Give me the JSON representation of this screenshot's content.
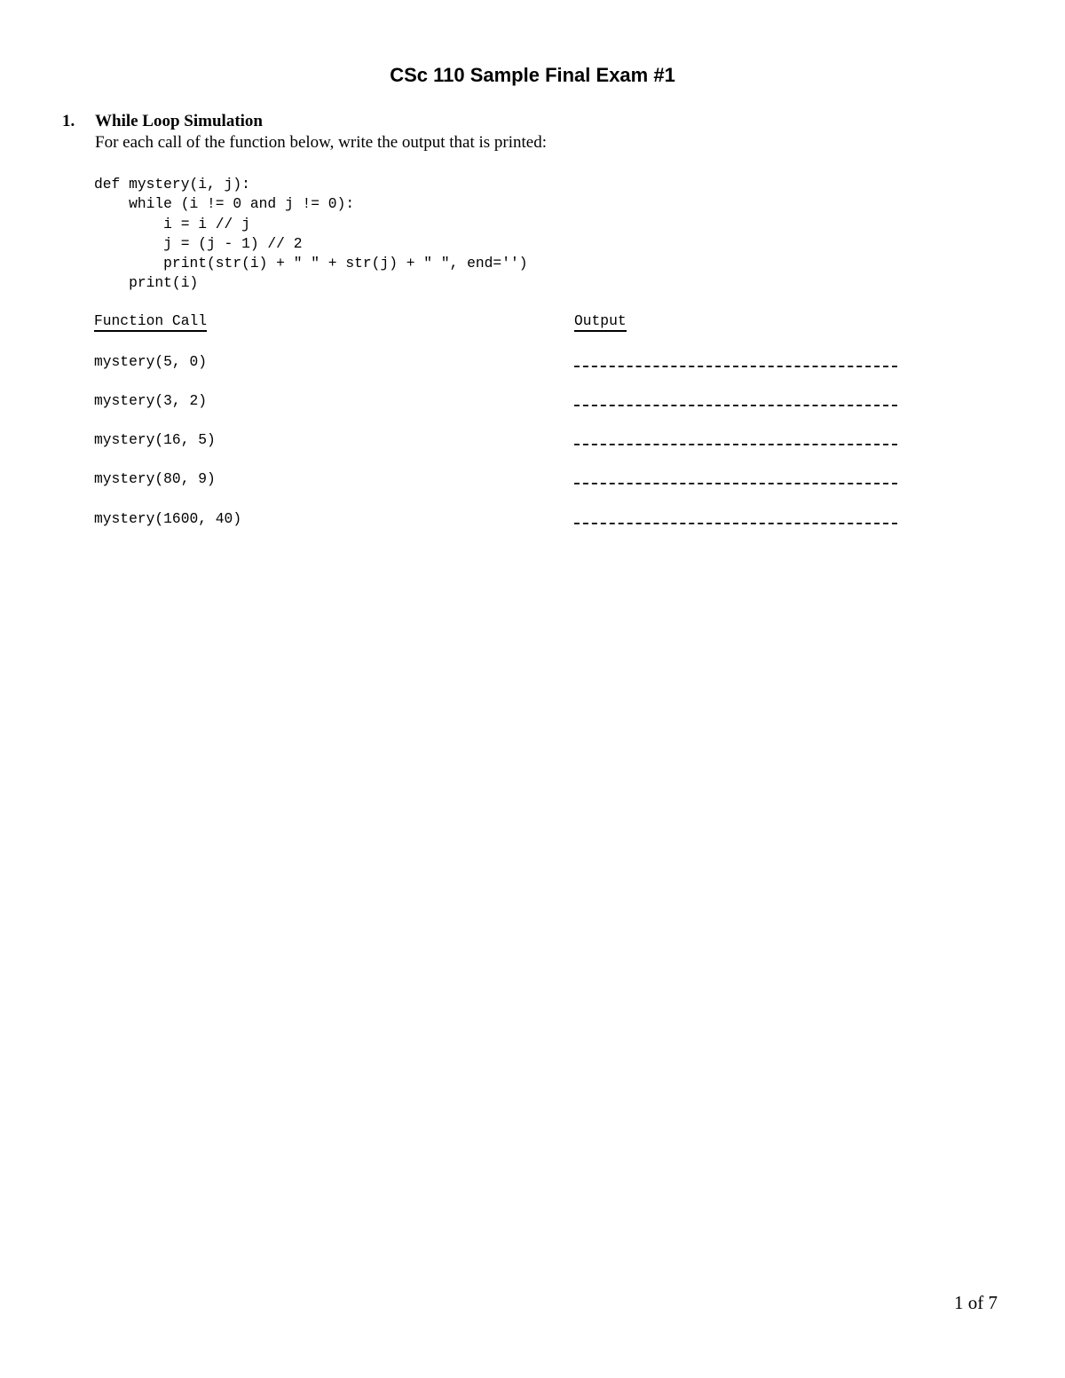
{
  "document": {
    "title": "CSc 110 Sample Final Exam #1",
    "page_number": "1 of 7"
  },
  "question": {
    "number": "1.",
    "heading": "While Loop Simulation",
    "instructions": "For each call of the function below, write the output that is printed:",
    "code_lines": [
      "def mystery(i, j):",
      "    while (i != 0 and j != 0):",
      "        i = i // j",
      "        j = (j - 1) // 2",
      "        print(str(i) + \" \" + str(j) + \" \", end='')",
      "    print(i)"
    ],
    "table": {
      "headers": {
        "function_call": "Function Call",
        "output": "Output"
      },
      "rows": [
        {
          "call": "mystery(5, 0)",
          "output": ""
        },
        {
          "call": "mystery(3, 2)",
          "output": ""
        },
        {
          "call": "mystery(16, 5)",
          "output": ""
        },
        {
          "call": "mystery(80, 9)",
          "output": ""
        },
        {
          "call": "mystery(1600, 40)",
          "output": ""
        }
      ]
    }
  }
}
